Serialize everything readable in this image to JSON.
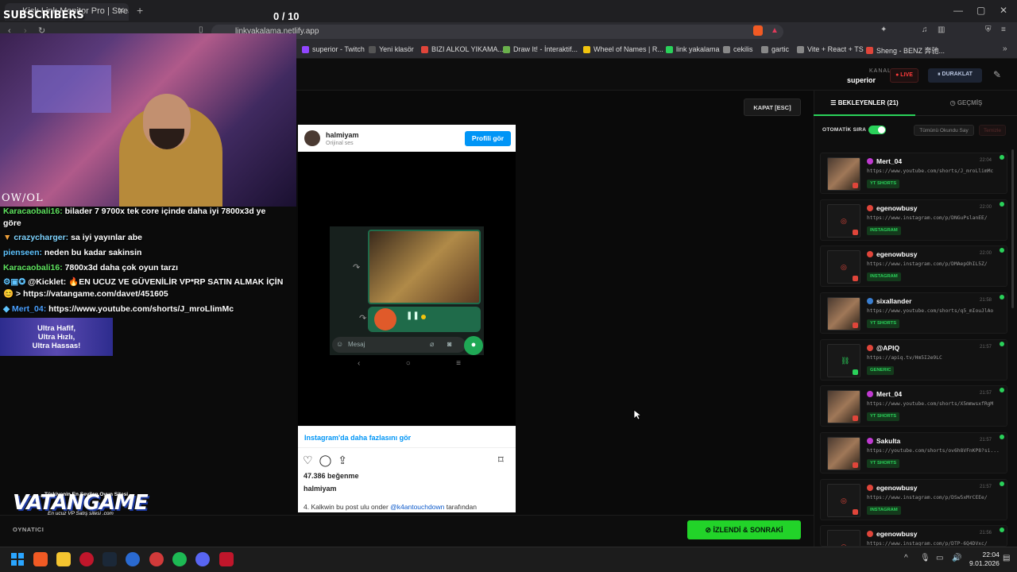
{
  "browser": {
    "tab_title": "Kick Link Monitor Pro | Strea",
    "url": "linkyakalama.netlify.app",
    "bookmarks": [
      "superior - Twitch",
      "Yeni klasör",
      "BIZI ALKOL YIKAMA...",
      "Draw It! - İnteraktif...",
      "Wheel of Names | R...",
      "link yakalama",
      "cekilis",
      "gartic",
      "Vite + React + TS",
      "Sheng - BENZ 奔驰..."
    ]
  },
  "overlay": {
    "subscribers_label": "SUBSCRIBERS",
    "sub_counter": "0  / 10",
    "owl_logo": "OW/OL",
    "chat": [
      {
        "user": "Karacaobali16:",
        "color": "#5fe35f",
        "text": " bilader 7 9700x tek core içinde daha iyi 7800x3d ye göre"
      },
      {
        "user": "crazycharger:",
        "color": "#7fd4ff",
        "text": " sa iyi yayınlar abe"
      },
      {
        "user": "pienseen:",
        "color": "#5fc4ff",
        "text": " neden bu kadar sakinsin"
      },
      {
        "user": "Karacaobali16:",
        "color": "#5fe35f",
        "text": " 7800x3d daha çok oyun tarzı"
      },
      {
        "user": "@Kicklet:",
        "color": "#ffffff",
        "text": " 🔥EN UCUZ VE GÜVENİLİR VP*RP SATIN ALMAK İÇİN 😊 > https://vatangame.com/davet/451605"
      },
      {
        "user": "Mert_04:",
        "color": "#4aa0ff",
        "text": " https://www.youtube.com/shorts/J_mroLlimMc"
      }
    ],
    "ultra_banner": [
      "Ultra Hafif,",
      "Ultra Hızlı,",
      "Ultra Hassas!"
    ],
    "vatan_subtitle": "Türkiyenin En Sevilen Oyun Sitesi",
    "vatan_logo": "VATANGAME",
    "vatan_tagline": "En ucuz VP Satış sitesi   .com"
  },
  "header": {
    "kanal_label": "KANAL",
    "kanal_name": "superior",
    "live_label": "● LIVE",
    "pause_label": "⏸ DURAKLAT"
  },
  "viewer": {
    "close_label": "KAPAT [ESC]",
    "ig_user": "halmiyam",
    "ig_sound": "Orijinal ses",
    "ig_profile_btn": "Profili gör",
    "phone_input_placeholder": "Mesaj",
    "ig_more": "Instagram'da daha fazlasını gör",
    "ig_likes": "47.386 beğenme",
    "ig_caption_pre": "4. Kalkwin bu post ulu onder ",
    "ig_caption_mention": "@k4antouchdown",
    "ig_caption_post": " tarafından"
  },
  "bottom": {
    "player_label": "OYNATICI",
    "next_label": "⊘  İZLENDİ & SONRAKİ"
  },
  "sidebar": {
    "tab_queue": "☰  BEKLEYENLER (21)",
    "tab_history": "◷  GEÇMİŞ",
    "auto_label": "OTOMATİK SIRA",
    "mark_all": "Tümünü Okundu Say",
    "clear": "Temizle",
    "items": [
      {
        "name": "Mert_04",
        "time": "22:04",
        "url": "https://www.youtube.com/shorts/J_mroLlimMc",
        "tag": "YT SHORTS",
        "dot": "#c03ad1",
        "thumb": "img"
      },
      {
        "name": "egenowbusy",
        "time": "22:00",
        "url": "https://www.instagram.com/p/DNGuPslanEE/",
        "tag": "INSTAGRAM",
        "dot": "#e0453a",
        "thumb": "ig"
      },
      {
        "name": "egenowbusy",
        "time": "22:00",
        "url": "https://www.instagram.com/p/DMAepOhIL5Z/",
        "tag": "INSTAGRAM",
        "dot": "#e0453a",
        "thumb": "ig"
      },
      {
        "name": "sixallander",
        "time": "21:58",
        "url": "https://www.youtube.com/shorts/q5_mIouJlAo",
        "tag": "YT SHORTS",
        "dot": "#3a7fd1",
        "thumb": "img"
      },
      {
        "name": "@APIQ",
        "time": "21:57",
        "url": "https://apiq.tv/Hm5I2e9LC",
        "tag": "GENERIC",
        "dot": "#e0453a",
        "thumb": "link"
      },
      {
        "name": "Mert_04",
        "time": "21:57",
        "url": "https://www.youtube.com/shorts/X5mmwsxfRgM",
        "tag": "YT SHORTS",
        "dot": "#c03ad1",
        "thumb": "img"
      },
      {
        "name": "Sakulta",
        "time": "21:57",
        "url": "https://youtube.com/shorts/ov6h8VFnKP8?si...",
        "tag": "YT SHORTS",
        "dot": "#c03ad1",
        "thumb": "img"
      },
      {
        "name": "egenowbusy",
        "time": "21:57",
        "url": "https://www.instagram.com/p/DSw5xMrCEEe/",
        "tag": "INSTAGRAM",
        "dot": "#e0453a",
        "thumb": "ig"
      },
      {
        "name": "egenowbusy",
        "time": "21:56",
        "url": "https://www.instagram.com/p/DTP-6Q4DVxc/",
        "tag": "",
        "dot": "#e0453a",
        "thumb": "ig"
      }
    ]
  },
  "taskbar": {
    "time": "22:04",
    "date": "9.01.2026"
  }
}
